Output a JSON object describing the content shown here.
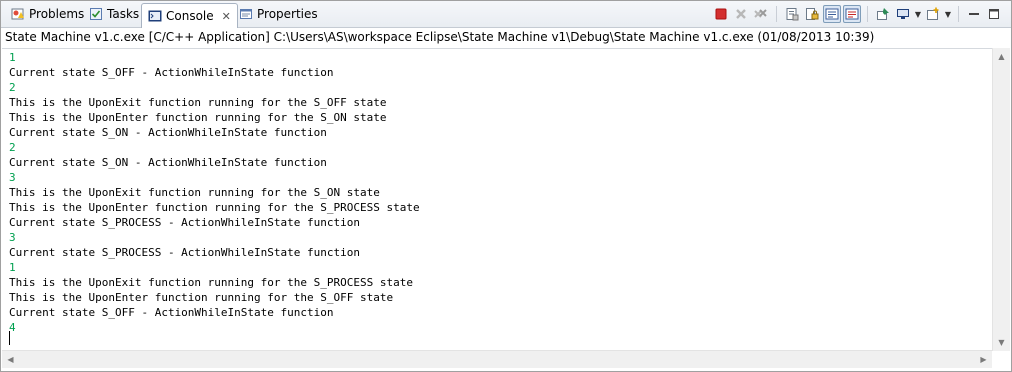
{
  "tabs": [
    {
      "label": "Problems",
      "icon": "problems-icon"
    },
    {
      "label": "Tasks",
      "icon": "tasks-icon"
    },
    {
      "label": "Console",
      "icon": "console-icon",
      "active": true,
      "close": "✕"
    },
    {
      "label": "Properties",
      "icon": "properties-icon"
    }
  ],
  "toolbar": {
    "buttons": [
      "terminate-icon",
      "remove-launch-icon",
      "remove-all-terminated-icon",
      "clear-console-icon",
      "scroll-lock-icon",
      "show-on-stdout-icon",
      "show-on-stderr-icon",
      "pin-console-icon",
      "display-selected-console-icon",
      "open-console-icon",
      "minimize-icon",
      "maximize-icon"
    ]
  },
  "launch_title": "State Machine v1.c.exe [C/C++ Application] C:\\Users\\AS\\workspace Eclipse\\State Machine v1\\Debug\\State Machine v1.c.exe (01/08/2013 10:39)",
  "console": {
    "lines": [
      {
        "text": "1",
        "type": "input"
      },
      {
        "text": "Current state S_OFF - ActionWhileInState function",
        "type": "output"
      },
      {
        "text": "2",
        "type": "input"
      },
      {
        "text": "This is the UponExit function running for the S_OFF state",
        "type": "output"
      },
      {
        "text": "This is the UponEnter function running for the S_ON state",
        "type": "output"
      },
      {
        "text": "Current state S_ON - ActionWhileInState function",
        "type": "output"
      },
      {
        "text": "2",
        "type": "input"
      },
      {
        "text": "Current state S_ON - ActionWhileInState function",
        "type": "output"
      },
      {
        "text": "3",
        "type": "input"
      },
      {
        "text": "This is the UponExit function running for the S_ON state",
        "type": "output"
      },
      {
        "text": "This is the UponEnter function running for the S_PROCESS state",
        "type": "output"
      },
      {
        "text": "Current state S_PROCESS - ActionWhileInState function",
        "type": "output"
      },
      {
        "text": "3",
        "type": "input"
      },
      {
        "text": "Current state S_PROCESS - ActionWhileInState function",
        "type": "output"
      },
      {
        "text": "1",
        "type": "input"
      },
      {
        "text": "This is the UponExit function running for the S_PROCESS state",
        "type": "output"
      },
      {
        "text": "This is the UponEnter function running for the S_OFF state",
        "type": "output"
      },
      {
        "text": "Current state S_OFF - ActionWhileInState function",
        "type": "output"
      },
      {
        "text": "4",
        "type": "input"
      }
    ]
  },
  "colors": {
    "input_text": "#00a050",
    "output_text": "#000000",
    "terminate": "#d32f2f"
  }
}
